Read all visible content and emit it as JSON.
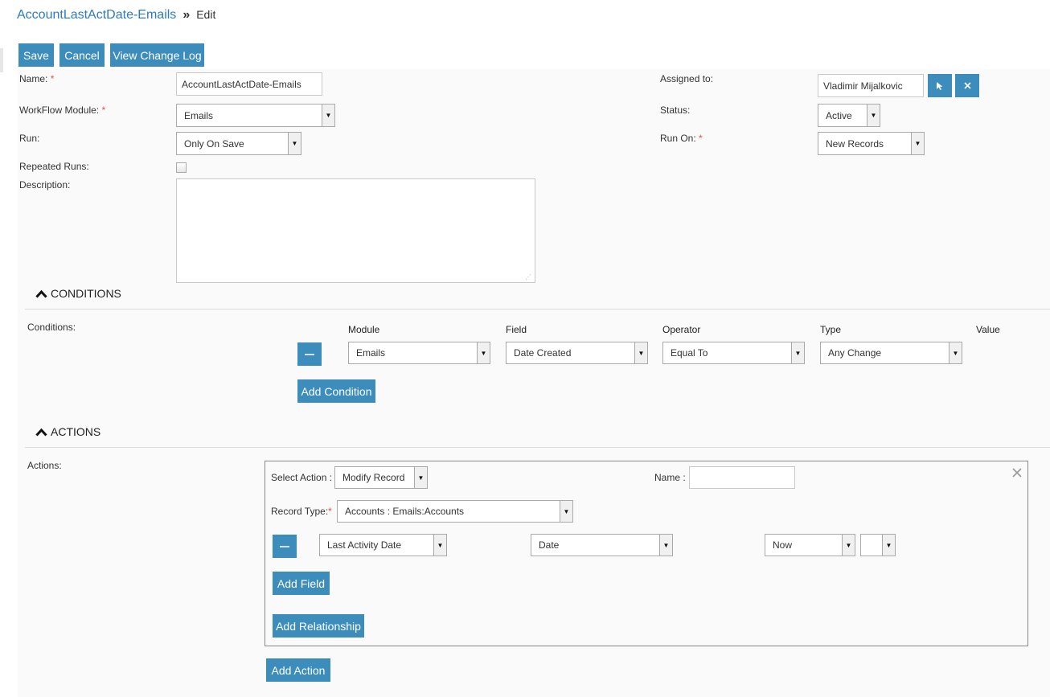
{
  "breadcrumb": {
    "title": "AccountLastActDate-Emails",
    "separator": "»",
    "current": "Edit"
  },
  "toolbar": {
    "save": "Save",
    "cancel": "Cancel",
    "view_change_log": "View Change Log"
  },
  "form": {
    "name_label": "Name:",
    "name_value": "AccountLastActDate-Emails",
    "module_label": "WorkFlow Module:",
    "module_value": "Emails",
    "run_label": "Run:",
    "run_value": "Only On Save",
    "repeated_label": "Repeated Runs:",
    "repeated_checked": false,
    "description_label": "Description:",
    "description_value": "",
    "assigned_label": "Assigned to:",
    "assigned_value": "Vladimir Mijalkovic",
    "status_label": "Status:",
    "status_value": "Active",
    "run_on_label": "Run On:",
    "run_on_value": "New Records",
    "required_mark": "*"
  },
  "conditions": {
    "section_title": "CONDITIONS",
    "label": "Conditions:",
    "columns": [
      "Module",
      "Field",
      "Operator",
      "Type",
      "Value"
    ],
    "row": {
      "module": "Emails",
      "field": "Date Created",
      "operator": "Equal To",
      "type": "Any Change"
    },
    "add_button": "Add Condition"
  },
  "actions": {
    "section_title": "ACTIONS",
    "label": "Actions:",
    "select_action_label": "Select Action :",
    "select_action_value": "Modify Record",
    "name_label": "Name :",
    "name_value": "",
    "record_type_label": "Record Type:",
    "record_type_value": "Accounts : Emails:Accounts",
    "field_row": {
      "field": "Last Activity Date",
      "type": "Date",
      "value": "Now",
      "extra": ""
    },
    "add_field": "Add Field",
    "add_relationship": "Add Relationship",
    "add_action": "Add Action"
  },
  "colors": {
    "accent": "#3c8dbc",
    "link": "#2e7bbf",
    "required": "#d9534f"
  }
}
